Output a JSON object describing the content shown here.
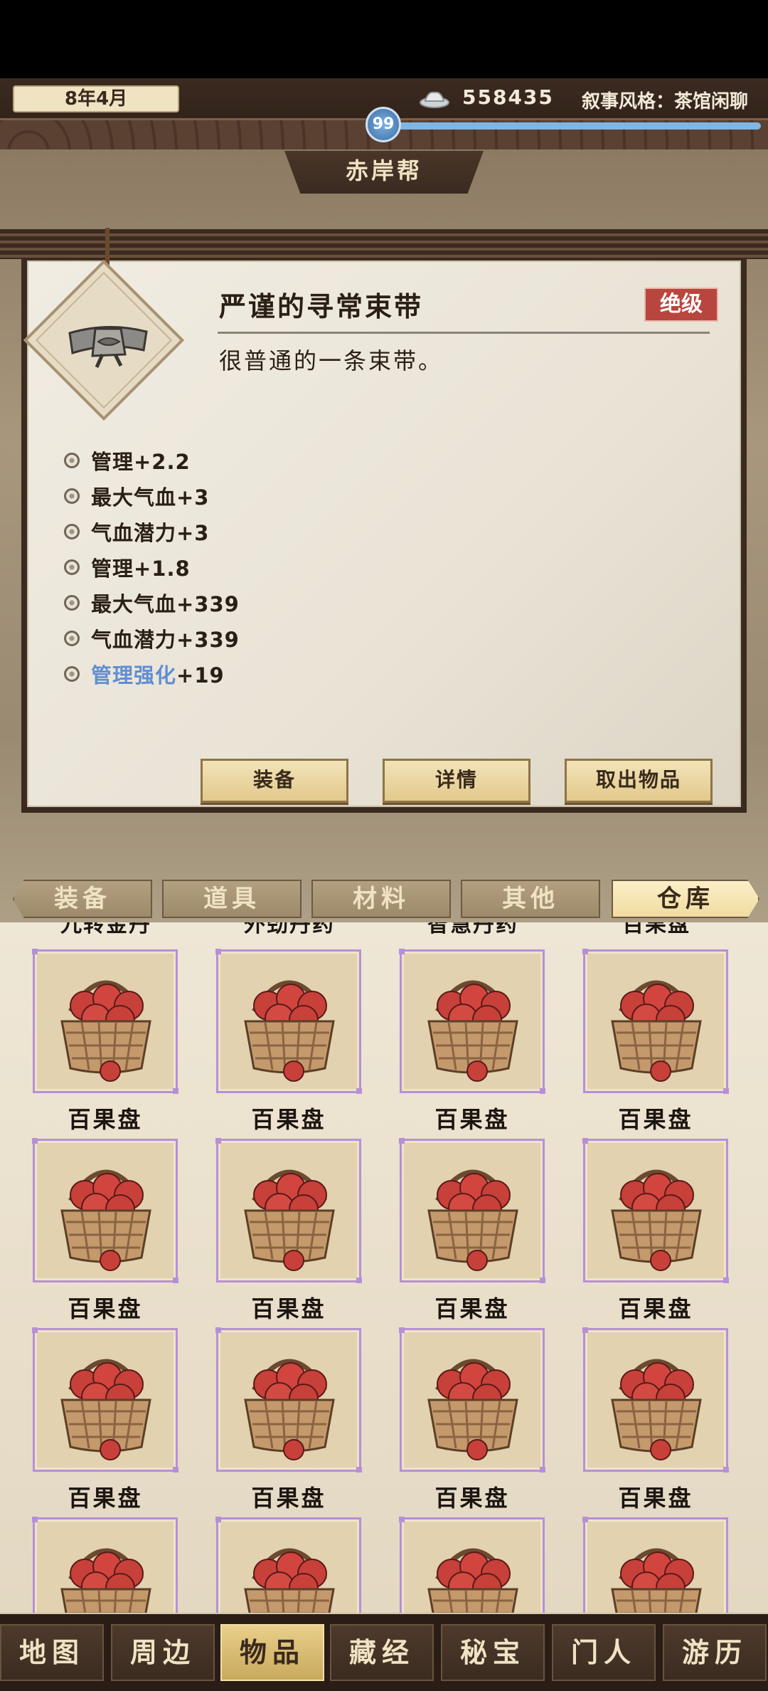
{
  "header": {
    "date": "8年4月",
    "silver": "558435",
    "narrative_style": "叙事风格：茶馆闲聊",
    "level": "99"
  },
  "section_title": "赤岸帮",
  "item_detail": {
    "name": "严谨的寻常束带",
    "grade": "绝级",
    "description": "很普通的一条束带。",
    "stats": [
      {
        "text": "管理+2.2"
      },
      {
        "text": "最大气血+3"
      },
      {
        "text": "气血潜力+3"
      },
      {
        "text": "管理+1.8"
      },
      {
        "text": "最大气血+339"
      },
      {
        "text": "气血潜力+339"
      }
    ],
    "special_stat": {
      "label": "管理强化",
      "value": "+19"
    },
    "buttons": {
      "equip": "装备",
      "details": "详情",
      "take_out": "取出物品"
    }
  },
  "category_tabs": [
    "装备",
    "道具",
    "材料",
    "其他",
    "仓库"
  ],
  "active_category": "仓库",
  "grid": {
    "partial_row_names": [
      "九转金丹",
      "外劲丹药",
      "智慧丹药",
      "百果盘"
    ],
    "rows": [
      [
        "百果盘",
        "百果盘",
        "百果盘",
        "百果盘"
      ],
      [
        "百果盘",
        "百果盘",
        "百果盘",
        "百果盘"
      ],
      [
        "百果盘",
        "百果盘",
        "百果盘",
        "百果盘"
      ]
    ],
    "item_icon": "fruit-basket-icon",
    "rarity_color": "#b690d6"
  },
  "bottom_nav": [
    "地图",
    "周边",
    "物品",
    "藏经",
    "秘宝",
    "门人",
    "游历"
  ],
  "active_nav": "物品",
  "colors": {
    "grade_red": "#b9463e",
    "link_blue": "#5f8fd3",
    "xp_blue": "#7fb6e3"
  }
}
